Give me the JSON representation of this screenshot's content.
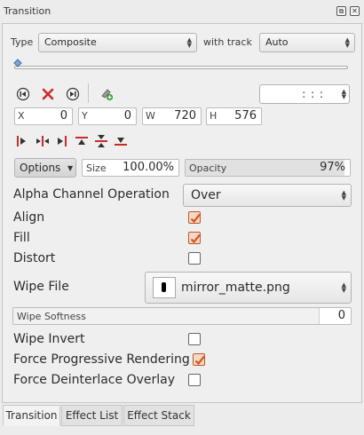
{
  "window": {
    "title": "Transition",
    "float_button": "⧉",
    "close_button": "✕"
  },
  "type_row": {
    "type_label": "Type",
    "type_value": "Composite",
    "track_label": "with track",
    "track_value": "Auto"
  },
  "timecode": {
    "value": ": : :"
  },
  "geometry": {
    "x_label": "X",
    "x_value": "0",
    "y_label": "Y",
    "y_value": "0",
    "w_label": "W",
    "w_value": "720",
    "h_label": "H",
    "h_value": "576"
  },
  "options_row": {
    "options_label": "Options",
    "size_label": "Size",
    "size_value": "100.00%",
    "opacity_label": "Opacity",
    "opacity_value": "97%",
    "opacity_level": 0.97
  },
  "params": {
    "alpha_label": "Alpha Channel Operation",
    "alpha_value": "Over",
    "align_label": "Align",
    "align_checked": true,
    "fill_label": "Fill",
    "fill_checked": true,
    "distort_label": "Distort",
    "distort_checked": false,
    "wipe_file_label": "Wipe File",
    "wipe_file_value": "mirror_matte.png",
    "wipe_softness_label": "Wipe Softness",
    "wipe_softness_value": "0",
    "wipe_invert_label": "Wipe Invert",
    "wipe_invert_checked": false,
    "force_prog_label": "Force Progressive Rendering",
    "force_prog_checked": true,
    "force_deint_label": "Force Deinterlace Overlay",
    "force_deint_checked": false
  },
  "tabs": [
    {
      "label": "Transition",
      "active": true
    },
    {
      "label": "Effect List",
      "active": false
    },
    {
      "label": "Effect Stack",
      "active": false
    }
  ],
  "colors": {
    "accent": "#d9541e",
    "checkbox_accent": "#c0581e",
    "icon_red": "#cc2a2a"
  }
}
